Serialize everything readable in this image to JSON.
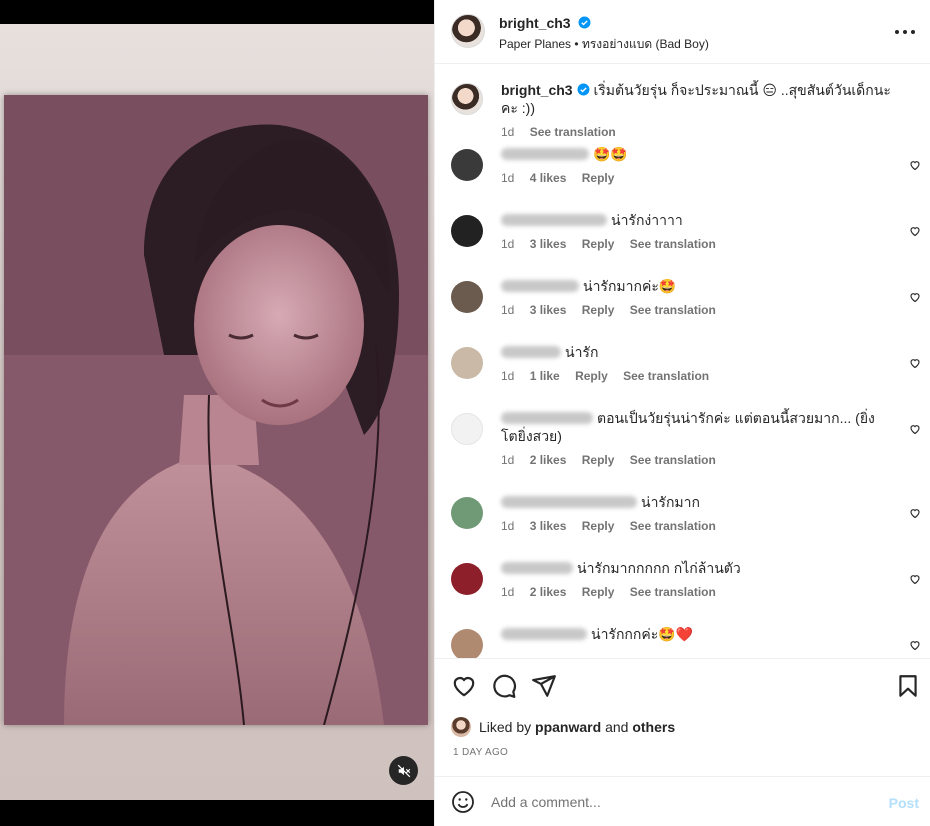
{
  "header": {
    "username": "bright_ch3",
    "music": "Paper Planes",
    "separator": "•",
    "audio_title": "ทรงอย่างแบด (Bad Boy)",
    "more_icon": "more-horizontal-icon"
  },
  "caption": {
    "username": "bright_ch3",
    "text": "เริ่มต้นวัยรุ่น ก็จะประมาณนี้ 😑 ..สุขสันต์วันเด็กนะคะ :))",
    "time": "1d",
    "see_translation": "See translation"
  },
  "comments": [
    {
      "text": "🤩🤩",
      "time": "1d",
      "likes": "4 likes",
      "reply": "Reply",
      "translate": "",
      "avatar_color": "#3a3a3a"
    },
    {
      "text": "น่ารักง่าาาา",
      "time": "1d",
      "likes": "3 likes",
      "reply": "Reply",
      "translate": "See translation",
      "avatar_color": "#222222"
    },
    {
      "text": "น่ารักมากค่ะ🤩",
      "time": "1d",
      "likes": "3 likes",
      "reply": "Reply",
      "translate": "See translation",
      "avatar_color": "#6b5a4e"
    },
    {
      "text": "น่ารัก",
      "time": "1d",
      "likes": "1 like",
      "reply": "Reply",
      "translate": "See translation",
      "avatar_color": "#c9b9a6"
    },
    {
      "text": "ตอนเป็นวัยรุ่นน่ารักค่ะ แต่ตอนนี้สวยมาก... (ยิ่งโตยิ่งสวย)",
      "time": "1d",
      "likes": "2 likes",
      "reply": "Reply",
      "translate": "See translation",
      "avatar_color": "#f2f2f2"
    },
    {
      "text": "น่ารักมาก",
      "time": "1d",
      "likes": "3 likes",
      "reply": "Reply",
      "translate": "See translation",
      "avatar_color": "#6f9a75"
    },
    {
      "text": "น่ารักมากกกกก กไก่ล้านตัว",
      "time": "1d",
      "likes": "2 likes",
      "reply": "Reply",
      "translate": "See translation",
      "avatar_color": "#8c1f2a"
    },
    {
      "text": "น่ารักกกค่ะ🤩❤️",
      "time": "",
      "likes": "",
      "reply": "",
      "translate": "",
      "avatar_color": "#b08a70"
    }
  ],
  "actions": {
    "like_icon": "heart-icon",
    "comment_icon": "comment-icon",
    "share_icon": "share-icon",
    "save_icon": "bookmark-icon"
  },
  "liked_by": {
    "prefix": "Liked by",
    "user": "ppanward",
    "and": "and",
    "others": "others"
  },
  "timestamp": "1 DAY AGO",
  "add_comment": {
    "placeholder": "Add a comment...",
    "post_label": "Post"
  },
  "colors": {
    "verified": "#0095f6",
    "post_disabled": "#b2dffc",
    "secondary_text": "#737373"
  }
}
